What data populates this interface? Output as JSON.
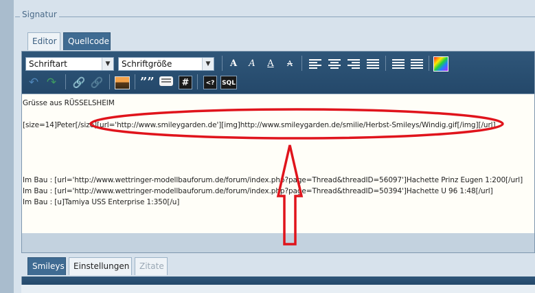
{
  "fieldset": {
    "legend": "Signatur"
  },
  "editor_tabs": [
    {
      "label": "Editor",
      "active": false
    },
    {
      "label": "Quellcode",
      "active": true
    }
  ],
  "toolbar": {
    "font_select": "Schriftart",
    "size_select": "Schriftgröße",
    "icons": [
      "bold-icon",
      "italic-icon",
      "underline-icon",
      "strikethrough-icon",
      "align-left-icon",
      "align-center-icon",
      "align-right-icon",
      "justify-icon",
      "bullet-list-icon",
      "numbered-list-icon",
      "color-icon",
      "undo-icon",
      "redo-icon",
      "link-icon",
      "unlink-icon",
      "image-icon",
      "quote-icon",
      "spoiler-icon",
      "hash-icon",
      "code-icon",
      "sql-icon"
    ],
    "quote_glyph": "””",
    "hash_glyph": "#",
    "code_glyph": "<?",
    "sql_glyph": "SQL"
  },
  "content": {
    "line1": "Grüsse aus RÜSSELSHEIM",
    "line2": "[size=14]Peter[/size][url='http://www.smileygarden.de'][img]http://www.smileygarden.de/smilie/Herbst-Smileys/Windig.gif[/img][/url]",
    "line3": "Im Bau : [url='http://www.wettringer-modellbauforum.de/forum/index.php?page=Thread&threadID=56097']Hachette Prinz Eugen 1:200[/url]",
    "line4": "Im Bau : [url='http://www.wettringer-modellbauforum.de/forum/index.php?page=Thread&threadID=50394']Hachette U 96 1:48[/url]",
    "line5": "Im Bau : [u]Tamiya USS Enterprise 1:350[/u]"
  },
  "bottom_tabs": [
    {
      "label": "Smileys",
      "active": true
    },
    {
      "label": "Einstellungen",
      "active": false
    },
    {
      "label": "Zitate",
      "active": false,
      "disabled": true
    }
  ],
  "annotation": {
    "color": "#e0141c",
    "shapes": [
      "ellipse",
      "up-arrow"
    ]
  }
}
